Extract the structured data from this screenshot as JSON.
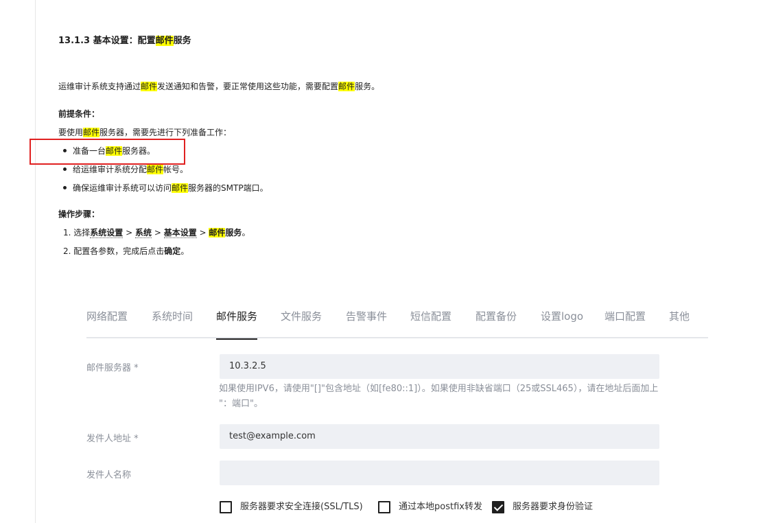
{
  "doc": {
    "title": {
      "a": "13.1.3 基本设置：配置",
      "hl": "邮件",
      "b": "服务"
    },
    "intro": {
      "a": "运维审计系统支持通过",
      "hl1": "邮件",
      "b": "发送通知和告警，要正常使用这些功能，需要配置",
      "hl2": "邮件",
      "c": "服务。"
    },
    "prereq_heading": "前提条件：",
    "prereq_lead": {
      "a": "要使用",
      "hl": "邮件",
      "b": "服务器，需要先进行下列准备工作："
    },
    "prereq_items": [
      {
        "a": "准备一台",
        "hl": "邮件",
        "b": "服务器。"
      },
      {
        "a": "给运维审计系统分配",
        "hl": "邮件",
        "b": "帐号。"
      },
      {
        "a": "确保运维审计系统可以访问",
        "hl": "邮件",
        "b": "服务器的SMTP端口。"
      }
    ],
    "steps_heading": "操作步骤：",
    "step1": {
      "num": "1.",
      "a": "选择",
      "p1": "系统设置",
      "s1": " > ",
      "p2": "系统",
      "s2": " > ",
      "p3": "基本设置",
      "s3": " > ",
      "p4hl": "邮件",
      "p4": "服务",
      "end": "。"
    },
    "step2": {
      "num": "2.",
      "a": "配置各参数，完成后点击",
      "b": "确定",
      "end": "。"
    }
  },
  "tabs": [
    {
      "label": "网络配置",
      "active": false
    },
    {
      "label": "系统时间",
      "active": false
    },
    {
      "label": "邮件服务",
      "active": true
    },
    {
      "label": "文件服务",
      "active": false
    },
    {
      "label": "告警事件",
      "active": false
    },
    {
      "label": "短信配置",
      "active": false
    },
    {
      "label": "配置备份",
      "active": false
    },
    {
      "label": "设置logo",
      "active": false
    },
    {
      "label": "端口配置",
      "active": false
    },
    {
      "label": "其他",
      "active": false
    }
  ],
  "form": {
    "server_label": "邮件服务器 *",
    "server_value": "10.3.2.5",
    "server_hint": "如果使用IPV6，请使用\"[]\"包含地址（如[fe80::1]）。如果使用非缺省端口（25或SSL465），请在地址后面加上 \"：端口\"。",
    "sender_label": "发件人地址 *",
    "sender_value": "test@example.com",
    "sender_name_label": "发件人名称",
    "sender_name_value": ""
  },
  "checkboxes": [
    {
      "label": "服务器要求安全连接(SSL/TLS)",
      "checked": false
    },
    {
      "label": "通过本地postfix转发",
      "checked": false
    },
    {
      "label": "服务器要求身份验证",
      "checked": true
    }
  ],
  "colors": {
    "highlight": "#ffff00",
    "annotation_box": "#e02020"
  }
}
